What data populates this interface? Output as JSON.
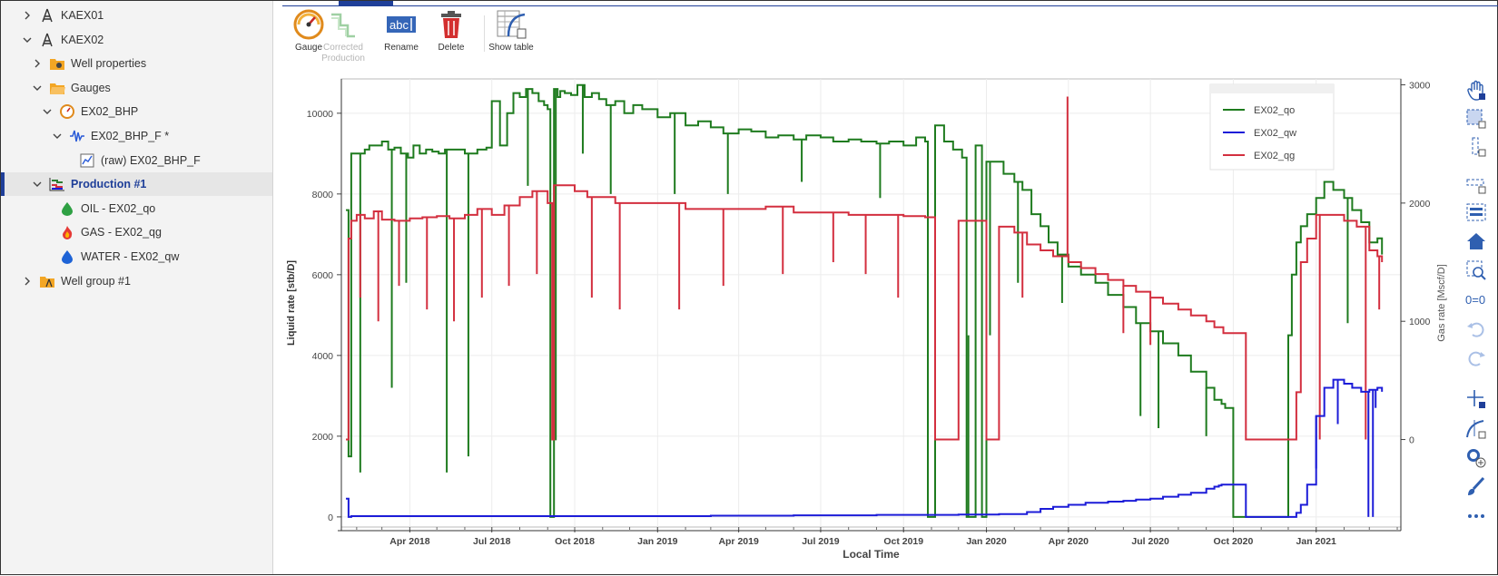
{
  "tree": [
    {
      "label": "KAEX01",
      "icon": "well-rig-icon",
      "level": 0,
      "chevron": "right"
    },
    {
      "label": "KAEX02",
      "icon": "well-rig-icon",
      "level": 0,
      "chevron": "down"
    },
    {
      "label": "Well properties",
      "icon": "well-properties-folder-icon",
      "level": 1,
      "chevron": "right"
    },
    {
      "label": "Gauges",
      "icon": "folder-icon",
      "level": 1,
      "chevron": "down"
    },
    {
      "label": "EX02_BHP",
      "icon": "gauge-icon",
      "level": 2,
      "chevron": "down"
    },
    {
      "label": "EX02_BHP_F *",
      "icon": "signal-wave-icon",
      "level": 3,
      "chevron": "down"
    },
    {
      "label": "(raw) EX02_BHP_F",
      "icon": "line-chart-icon",
      "level": 4,
      "chevron": ""
    },
    {
      "label": "Production #1",
      "icon": "production-icon",
      "level": 1,
      "chevron": "down",
      "selected": true
    },
    {
      "label": "OIL - EX02_qo",
      "icon": "oil-drop-icon",
      "level": 2,
      "chevron": ""
    },
    {
      "label": "GAS - EX02_qg",
      "icon": "gas-flame-icon",
      "level": 2,
      "chevron": ""
    },
    {
      "label": "WATER - EX02_qw",
      "icon": "water-drop-icon",
      "level": 2,
      "chevron": ""
    },
    {
      "label": "Well group #1",
      "icon": "well-group-folder-icon",
      "level": 0,
      "chevron": "right"
    }
  ],
  "toolbar": {
    "gauge": "Gauge",
    "corrected_production": "Corrected Production",
    "rename": "Rename",
    "delete": "Delete",
    "show_table": "Show table"
  },
  "right_tools": [
    "pan-hand-icon",
    "box-zoom-icon",
    "x-zoom-icon",
    "y-zoom-icon",
    "select-icon",
    "home-icon",
    "zoom-region-icon",
    "reset-zero-icon",
    "undo-icon",
    "redo-icon",
    "crosshair-icon",
    "point-edit-icon",
    "add-point-icon",
    "brush-icon",
    "more-icon"
  ],
  "chart_data": {
    "type": "line",
    "xlabel": "Local Time",
    "ylabel_left": "Liquid rate [stb/D]",
    "ylabel_right": "Gas rate [Mscf/D]",
    "x_ticks": [
      "Apr 2018",
      "Jul 2018",
      "Oct 2018",
      "Jan 2019",
      "Apr 2019",
      "Jul 2019",
      "Oct 2019",
      "Jan 2020",
      "Apr 2020",
      "Jul 2020",
      "Oct 2020",
      "Jan 2021"
    ],
    "y_left_ticks": [
      0,
      2000,
      4000,
      6000,
      8000,
      10000
    ],
    "y_right_ticks": [
      0,
      1000,
      2000,
      3000
    ],
    "ylim_left": [
      -250,
      10850
    ],
    "ylim_right": [
      -740,
      3050
    ],
    "xlim": [
      "2018-01-15",
      "2021-04-05"
    ],
    "legend_position": "top-right",
    "grid": true,
    "series": [
      {
        "name": "EX02_qo",
        "axis": "left",
        "color": "#1e7b1e",
        "x": [
          "2018-01-20",
          "2018-01-23",
          "2018-01-26",
          "2018-02-01",
          "2018-02-10",
          "2018-02-15",
          "2018-02-22",
          "2018-03-01",
          "2018-03-08",
          "2018-03-15",
          "2018-03-22",
          "2018-03-30",
          "2018-04-05",
          "2018-04-12",
          "2018-04-19",
          "2018-04-26",
          "2018-05-03",
          "2018-05-10",
          "2018-05-20",
          "2018-06-01",
          "2018-06-15",
          "2018-06-25",
          "2018-07-01",
          "2018-07-10",
          "2018-07-18",
          "2018-07-25",
          "2018-08-01",
          "2018-08-08",
          "2018-08-15",
          "2018-08-22",
          "2018-08-28",
          "2018-09-01",
          "2018-09-04",
          "2018-09-08",
          "2018-09-12",
          "2018-09-15",
          "2018-09-20",
          "2018-09-27",
          "2018-10-04",
          "2018-10-12",
          "2018-10-20",
          "2018-10-28",
          "2018-11-05",
          "2018-11-15",
          "2018-11-25",
          "2018-12-05",
          "2018-12-15",
          "2019-01-01",
          "2019-01-15",
          "2019-02-01",
          "2019-02-15",
          "2019-03-01",
          "2019-03-15",
          "2019-04-01",
          "2019-04-15",
          "2019-05-01",
          "2019-05-15",
          "2019-06-01",
          "2019-06-15",
          "2019-07-01",
          "2019-07-15",
          "2019-08-01",
          "2019-08-15",
          "2019-09-01",
          "2019-09-15",
          "2019-10-01",
          "2019-10-15",
          "2019-10-25",
          "2019-10-28",
          "2019-11-05",
          "2019-11-15",
          "2019-11-25",
          "2019-12-05",
          "2019-12-10",
          "2019-12-20",
          "2019-12-27",
          "2020-01-01",
          "2020-01-10",
          "2020-01-20",
          "2020-02-01",
          "2020-02-10",
          "2020-02-20",
          "2020-03-01",
          "2020-03-10",
          "2020-03-20",
          "2020-04-01",
          "2020-04-15",
          "2020-05-01",
          "2020-05-15",
          "2020-06-01",
          "2020-06-15",
          "2020-07-01",
          "2020-07-15",
          "2020-08-01",
          "2020-08-15",
          "2020-09-01",
          "2020-09-10",
          "2020-09-18",
          "2020-09-22",
          "2020-10-01",
          "2020-10-15",
          "2020-11-01",
          "2020-11-15",
          "2020-11-28",
          "2020-12-01",
          "2020-12-05",
          "2020-12-10",
          "2020-12-15",
          "2020-12-22",
          "2021-01-01",
          "2021-01-10",
          "2021-01-20",
          "2021-02-01",
          "2021-02-10",
          "2021-02-20",
          "2021-03-01",
          "2021-03-10",
          "2021-03-15"
        ],
        "y": [
          7600,
          1500,
          9000,
          9000,
          9100,
          9200,
          9200,
          9300,
          9100,
          9150,
          9000,
          8900,
          9200,
          9000,
          9100,
          9050,
          9000,
          9100,
          9100,
          9000,
          9100,
          9150,
          10300,
          9200,
          10000,
          10500,
          10400,
          10600,
          10500,
          10300,
          10200,
          10100,
          0,
          10600,
          10400,
          10550,
          10500,
          10450,
          10700,
          10400,
          10500,
          10350,
          10200,
          10300,
          10000,
          10200,
          10100,
          9900,
          10000,
          9700,
          9800,
          9650,
          9500,
          9600,
          9550,
          9400,
          9450,
          9350,
          9450,
          9400,
          9300,
          9350,
          9300,
          9250,
          9300,
          9200,
          9400,
          9300,
          0,
          9700,
          9300,
          9100,
          8900,
          0,
          9200,
          0,
          8800,
          8800,
          8500,
          8300,
          8100,
          7500,
          7200,
          6800,
          6500,
          6200,
          6000,
          5800,
          5500,
          5200,
          4800,
          4600,
          4300,
          4000,
          3600,
          3200,
          2900,
          2800,
          2700,
          0,
          0,
          0,
          0,
          0,
          4500,
          6000,
          6800,
          7200,
          7500,
          7900,
          8300,
          8100,
          7900,
          7600,
          7300,
          6800,
          6900,
          6500
        ],
        "dips": [
          [
            "2018-02-05",
            1100
          ],
          [
            "2018-03-12",
            3200
          ],
          [
            "2018-03-28",
            5800
          ],
          [
            "2018-05-12",
            1100
          ],
          [
            "2018-06-05",
            1500
          ],
          [
            "2018-08-10",
            8200
          ],
          [
            "2018-09-10",
            1900
          ],
          [
            "2018-10-10",
            9000
          ],
          [
            "2018-11-10",
            8000
          ],
          [
            "2019-01-20",
            8000
          ],
          [
            "2019-03-20",
            8000
          ],
          [
            "2019-06-10",
            8300
          ],
          [
            "2019-09-05",
            7900
          ],
          [
            "2019-12-12",
            4500
          ],
          [
            "2020-01-05",
            4500
          ],
          [
            "2020-02-05",
            5800
          ],
          [
            "2020-03-25",
            5300
          ],
          [
            "2020-06-20",
            2500
          ],
          [
            "2020-07-10",
            2200
          ],
          [
            "2020-09-01",
            2000
          ],
          [
            "2021-02-05",
            4800
          ]
        ]
      },
      {
        "name": "EX02_qw",
        "axis": "left",
        "color": "#1c1cd8",
        "x": [
          "2018-01-20",
          "2018-01-23",
          "2018-01-26",
          "2018-03-01",
          "2018-06-01",
          "2018-09-01",
          "2018-12-01",
          "2019-03-01",
          "2019-06-01",
          "2019-09-01",
          "2019-12-01",
          "2020-01-15",
          "2020-02-15",
          "2020-03-01",
          "2020-03-15",
          "2020-04-01",
          "2020-04-20",
          "2020-05-15",
          "2020-06-01",
          "2020-06-15",
          "2020-07-01",
          "2020-07-15",
          "2020-08-01",
          "2020-08-15",
          "2020-09-01",
          "2020-09-10",
          "2020-09-15",
          "2020-09-18",
          "2020-10-15",
          "2020-12-01",
          "2020-12-10",
          "2020-12-15",
          "2020-12-22",
          "2021-01-01",
          "2021-01-10",
          "2021-01-20",
          "2021-02-01",
          "2021-02-10",
          "2021-02-20",
          "2021-03-01",
          "2021-03-10",
          "2021-03-15"
        ],
        "y": [
          450,
          0,
          20,
          20,
          20,
          20,
          20,
          30,
          40,
          50,
          60,
          70,
          120,
          200,
          250,
          300,
          350,
          380,
          400,
          430,
          450,
          500,
          550,
          600,
          700,
          750,
          780,
          800,
          0,
          0,
          100,
          300,
          800,
          2500,
          3200,
          3400,
          3300,
          3200,
          3100,
          3150,
          3200,
          3100
        ],
        "dips": [
          [
            "2021-01-01",
            1200
          ],
          [
            "2021-01-25",
            2300
          ],
          [
            "2021-02-28",
            0
          ],
          [
            "2021-03-05",
            0
          ],
          [
            "2021-03-08",
            2700
          ]
        ]
      },
      {
        "name": "EX02_qg",
        "axis": "right",
        "color": "#d32f3f",
        "x": [
          "2018-01-20",
          "2018-01-23",
          "2018-01-26",
          "2018-02-01",
          "2018-02-10",
          "2018-02-20",
          "2018-03-01",
          "2018-03-15",
          "2018-04-01",
          "2018-04-15",
          "2018-05-01",
          "2018-05-15",
          "2018-06-01",
          "2018-06-15",
          "2018-07-01",
          "2018-07-15",
          "2018-08-01",
          "2018-08-15",
          "2018-09-01",
          "2018-09-06",
          "2018-09-08",
          "2018-09-15",
          "2018-10-01",
          "2018-10-15",
          "2018-11-01",
          "2018-11-15",
          "2018-12-01",
          "2019-01-01",
          "2019-02-01",
          "2019-03-01",
          "2019-04-01",
          "2019-05-01",
          "2019-06-01",
          "2019-07-01",
          "2019-08-01",
          "2019-09-01",
          "2019-10-01",
          "2019-10-25",
          "2019-11-05",
          "2019-12-01",
          "2019-12-20",
          "2020-01-01",
          "2020-01-15",
          "2020-02-01",
          "2020-02-15",
          "2020-03-01",
          "2020-03-15",
          "2020-04-01",
          "2020-04-15",
          "2020-05-01",
          "2020-05-15",
          "2020-06-01",
          "2020-06-15",
          "2020-07-01",
          "2020-07-15",
          "2020-08-01",
          "2020-08-15",
          "2020-09-01",
          "2020-09-10",
          "2020-09-20",
          "2020-10-15",
          "2020-11-15",
          "2020-12-01",
          "2020-12-10",
          "2020-12-15",
          "2020-12-22",
          "2021-01-01",
          "2021-01-15",
          "2021-02-01",
          "2021-02-15",
          "2021-03-01",
          "2021-03-10",
          "2021-03-15"
        ],
        "y": [
          0,
          1700,
          1850,
          1900,
          1870,
          1930,
          1860,
          1850,
          1870,
          1880,
          1890,
          1870,
          1900,
          1950,
          1900,
          1980,
          2050,
          2100,
          2000,
          0,
          2150,
          2150,
          2100,
          2050,
          2050,
          2000,
          2000,
          2000,
          1950,
          1950,
          1950,
          1970,
          1920,
          1920,
          1900,
          1900,
          1890,
          1880,
          0,
          1850,
          1850,
          0,
          1800,
          1750,
          1650,
          1600,
          1550,
          1500,
          1450,
          1400,
          1350,
          1300,
          1250,
          1200,
          1150,
          1100,
          1050,
          1000,
          950,
          900,
          0,
          0,
          0,
          400,
          1500,
          1700,
          1900,
          1900,
          1850,
          1800,
          1600,
          1550,
          1500
        ],
        "dips": [
          [
            "2018-02-05",
            1200
          ],
          [
            "2018-02-25",
            1000
          ],
          [
            "2018-03-20",
            1300
          ],
          [
            "2018-04-20",
            1100
          ],
          [
            "2018-05-20",
            1000
          ],
          [
            "2018-06-20",
            1200
          ],
          [
            "2018-07-20",
            1300
          ],
          [
            "2018-08-20",
            1400
          ],
          [
            "2018-10-20",
            1200
          ],
          [
            "2018-11-20",
            1100
          ],
          [
            "2019-01-25",
            1100
          ],
          [
            "2019-03-15",
            1300
          ],
          [
            "2019-05-20",
            1400
          ],
          [
            "2019-07-15",
            1500
          ],
          [
            "2019-08-20",
            1400
          ],
          [
            "2019-09-25",
            1200
          ],
          [
            "2020-02-10",
            1200
          ],
          [
            "2020-03-31",
            2900
          ],
          [
            "2020-06-01",
            900
          ],
          [
            "2020-07-01",
            800
          ],
          [
            "2021-01-05",
            0
          ],
          [
            "2021-02-25",
            0
          ],
          [
            "2021-03-12",
            1100
          ]
        ]
      }
    ]
  }
}
